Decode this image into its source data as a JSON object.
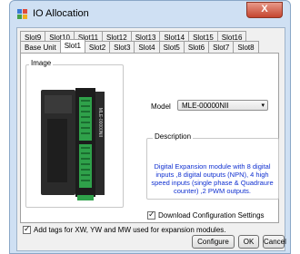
{
  "window": {
    "title": "IO Allocation",
    "close_label": "X"
  },
  "tabs_row1": [
    "Slot9",
    "Slot10",
    "Slot11",
    "Slot12",
    "Slot13",
    "Slot14",
    "Slot15",
    "Slot16"
  ],
  "tabs_row2": [
    "Base Unit",
    "Slot1",
    "Slot2",
    "Slot3",
    "Slot4",
    "Slot5",
    "Slot6",
    "Slot7",
    "Slot8"
  ],
  "active_tab": "Slot1",
  "image_group": {
    "label": "Image"
  },
  "model": {
    "label": "Model",
    "value": "MLE-00000NII"
  },
  "description": {
    "label": "Description",
    "text": "Digital Expansion module with 8 digital inputs ,8 digital outputs (NPN), 4 high speed inputs (single phase & Quadraure counter) ,2 PWM outputs."
  },
  "download_settings": {
    "label": "Download Configuration Settings",
    "checked": true
  },
  "add_tags": {
    "label": "Add tags for XW, YW and MW used for expansion  modules.",
    "checked": true
  },
  "buttons": {
    "configure": "Configure",
    "ok": "OK",
    "cancel": "Cancel"
  },
  "device": {
    "side_text": "MLE-00000NII"
  }
}
